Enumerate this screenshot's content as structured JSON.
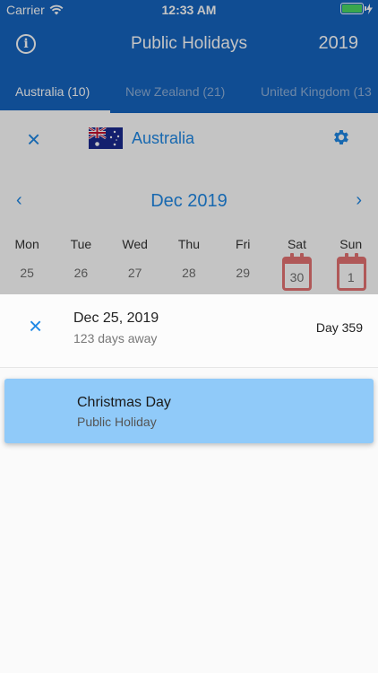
{
  "status": {
    "carrier": "Carrier",
    "time": "12:33 AM"
  },
  "appbar": {
    "title": "Public Holidays",
    "year": "2019",
    "info_glyph": "i"
  },
  "tabs": [
    {
      "label": "Australia (10)",
      "active": true
    },
    {
      "label": "New Zealand (21)",
      "active": false
    },
    {
      "label": "United Kingdom (13",
      "active": false
    }
  ],
  "country": {
    "name": "Australia",
    "close_glyph": "×"
  },
  "calendar": {
    "month": "Dec 2019",
    "prev_glyph": "‹",
    "next_glyph": "›",
    "weekdays": [
      "Mon",
      "Tue",
      "Wed",
      "Thu",
      "Fri",
      "Sat",
      "Sun"
    ],
    "row": [
      "25",
      "26",
      "27",
      "28",
      "29",
      "30",
      "1"
    ]
  },
  "sheet": {
    "close_glyph": "×",
    "date": "Dec 25, 2019",
    "subtitle": "123 days away",
    "day_label": "Day 359"
  },
  "holiday": {
    "name": "Christmas Day",
    "type": "Public Holiday"
  },
  "colors": {
    "primary": "#1565c0",
    "accent": "#1e88e5",
    "card": "#90caf9",
    "holiday_marker": "#e57373"
  }
}
